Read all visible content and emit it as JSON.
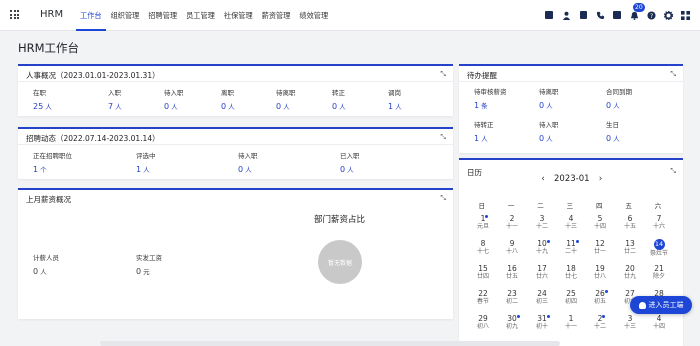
{
  "app": {
    "brand": "HRM"
  },
  "nav": [
    "工作台",
    "组织管理",
    "招聘管理",
    "员工管理",
    "社保管理",
    "薪资管理",
    "绩效管理"
  ],
  "header": {
    "icons": [
      "approval-icon",
      "user-icon",
      "document-icon",
      "phone-icon",
      "calendar-icon",
      "bell-icon",
      "help-icon",
      "gear-icon",
      "grid-icon"
    ],
    "notification_count": "20"
  },
  "page": {
    "title": "HRM工作台"
  },
  "hr_overview": {
    "title": "人事概况（2023.01.01-2023.01.31）",
    "stats": [
      {
        "label": "在职",
        "value": "25",
        "unit": "人"
      },
      {
        "label": "入职",
        "value": "7",
        "unit": "人"
      },
      {
        "label": "待入职",
        "value": "0",
        "unit": "人"
      },
      {
        "label": "离职",
        "value": "0",
        "unit": "人"
      },
      {
        "label": "待离职",
        "value": "0",
        "unit": "人"
      },
      {
        "label": "转正",
        "value": "0",
        "unit": "人"
      },
      {
        "label": "调岗",
        "value": "1",
        "unit": "人"
      }
    ]
  },
  "recruit": {
    "title": "招聘动态（2022.07.14-2023.01.14）",
    "stats": [
      {
        "label": "正在招聘职位",
        "value": "1",
        "unit": "个"
      },
      {
        "label": "评选中",
        "value": "1",
        "unit": "人"
      },
      {
        "label": "待入职",
        "value": "0",
        "unit": "人"
      },
      {
        "label": "已入职",
        "value": "0",
        "unit": "人"
      }
    ]
  },
  "salary": {
    "title": "上月薪资概况",
    "dept_title": "部门薪资占比",
    "no_data": "暂无数据",
    "stats": [
      {
        "label": "计薪人员",
        "value": "0",
        "unit": "人"
      },
      {
        "label": "实发工资",
        "value": "0",
        "unit": "元"
      }
    ]
  },
  "todo": {
    "title": "待办提醒",
    "stats": [
      {
        "label": "待审核薪资",
        "value": "1",
        "unit": "条"
      },
      {
        "label": "待离职",
        "value": "0",
        "unit": "人"
      },
      {
        "label": "合同到期",
        "value": "0",
        "unit": "人"
      },
      {
        "label": "待转正",
        "value": "1",
        "unit": "人"
      },
      {
        "label": "待入职",
        "value": "0",
        "unit": "人"
      },
      {
        "label": "生日",
        "value": "0",
        "unit": "人"
      }
    ]
  },
  "calendar": {
    "title": "日历",
    "month": "2023-01",
    "weekdays": [
      "日",
      "一",
      "二",
      "三",
      "四",
      "五",
      "六"
    ],
    "days": [
      {
        "n": "1",
        "l": "元旦",
        "dot": true
      },
      {
        "n": "2",
        "l": "十一",
        "dot": false
      },
      {
        "n": "3",
        "l": "十二",
        "dot": false
      },
      {
        "n": "4",
        "l": "十三",
        "dot": false
      },
      {
        "n": "5",
        "l": "十四",
        "dot": false
      },
      {
        "n": "6",
        "l": "十五",
        "dot": false
      },
      {
        "n": "7",
        "l": "十六",
        "dot": false
      },
      {
        "n": "8",
        "l": "十七",
        "dot": false
      },
      {
        "n": "9",
        "l": "十八",
        "dot": false
      },
      {
        "n": "10",
        "l": "十九",
        "dot": true
      },
      {
        "n": "11",
        "l": "二十",
        "dot": true
      },
      {
        "n": "12",
        "l": "廿一",
        "dot": false
      },
      {
        "n": "13",
        "l": "廿二",
        "dot": false
      },
      {
        "n": "14",
        "l": "祭灶节",
        "dot": false,
        "today": true
      },
      {
        "n": "15",
        "l": "廿四",
        "dot": false
      },
      {
        "n": "16",
        "l": "廿五",
        "dot": false
      },
      {
        "n": "17",
        "l": "廿六",
        "dot": false
      },
      {
        "n": "18",
        "l": "廿七",
        "dot": false
      },
      {
        "n": "19",
        "l": "廿八",
        "dot": false
      },
      {
        "n": "20",
        "l": "廿九",
        "dot": false
      },
      {
        "n": "21",
        "l": "除夕",
        "dot": false
      },
      {
        "n": "22",
        "l": "春节",
        "dot": false
      },
      {
        "n": "23",
        "l": "初二",
        "dot": false
      },
      {
        "n": "24",
        "l": "初三",
        "dot": false
      },
      {
        "n": "25",
        "l": "初四",
        "dot": false
      },
      {
        "n": "26",
        "l": "初五",
        "dot": true
      },
      {
        "n": "27",
        "l": "初六",
        "dot": false
      },
      {
        "n": "28",
        "l": "初七",
        "dot": false
      },
      {
        "n": "29",
        "l": "初八",
        "dot": false
      },
      {
        "n": "30",
        "l": "初九",
        "dot": true
      },
      {
        "n": "31",
        "l": "初十",
        "dot": true
      },
      {
        "n": "1",
        "l": "十一",
        "dot": false
      },
      {
        "n": "2",
        "l": "十二",
        "dot": true
      },
      {
        "n": "3",
        "l": "十三",
        "dot": false
      },
      {
        "n": "4",
        "l": "十四",
        "dot": false
      }
    ]
  },
  "float_button": {
    "label": "进入员工端"
  }
}
